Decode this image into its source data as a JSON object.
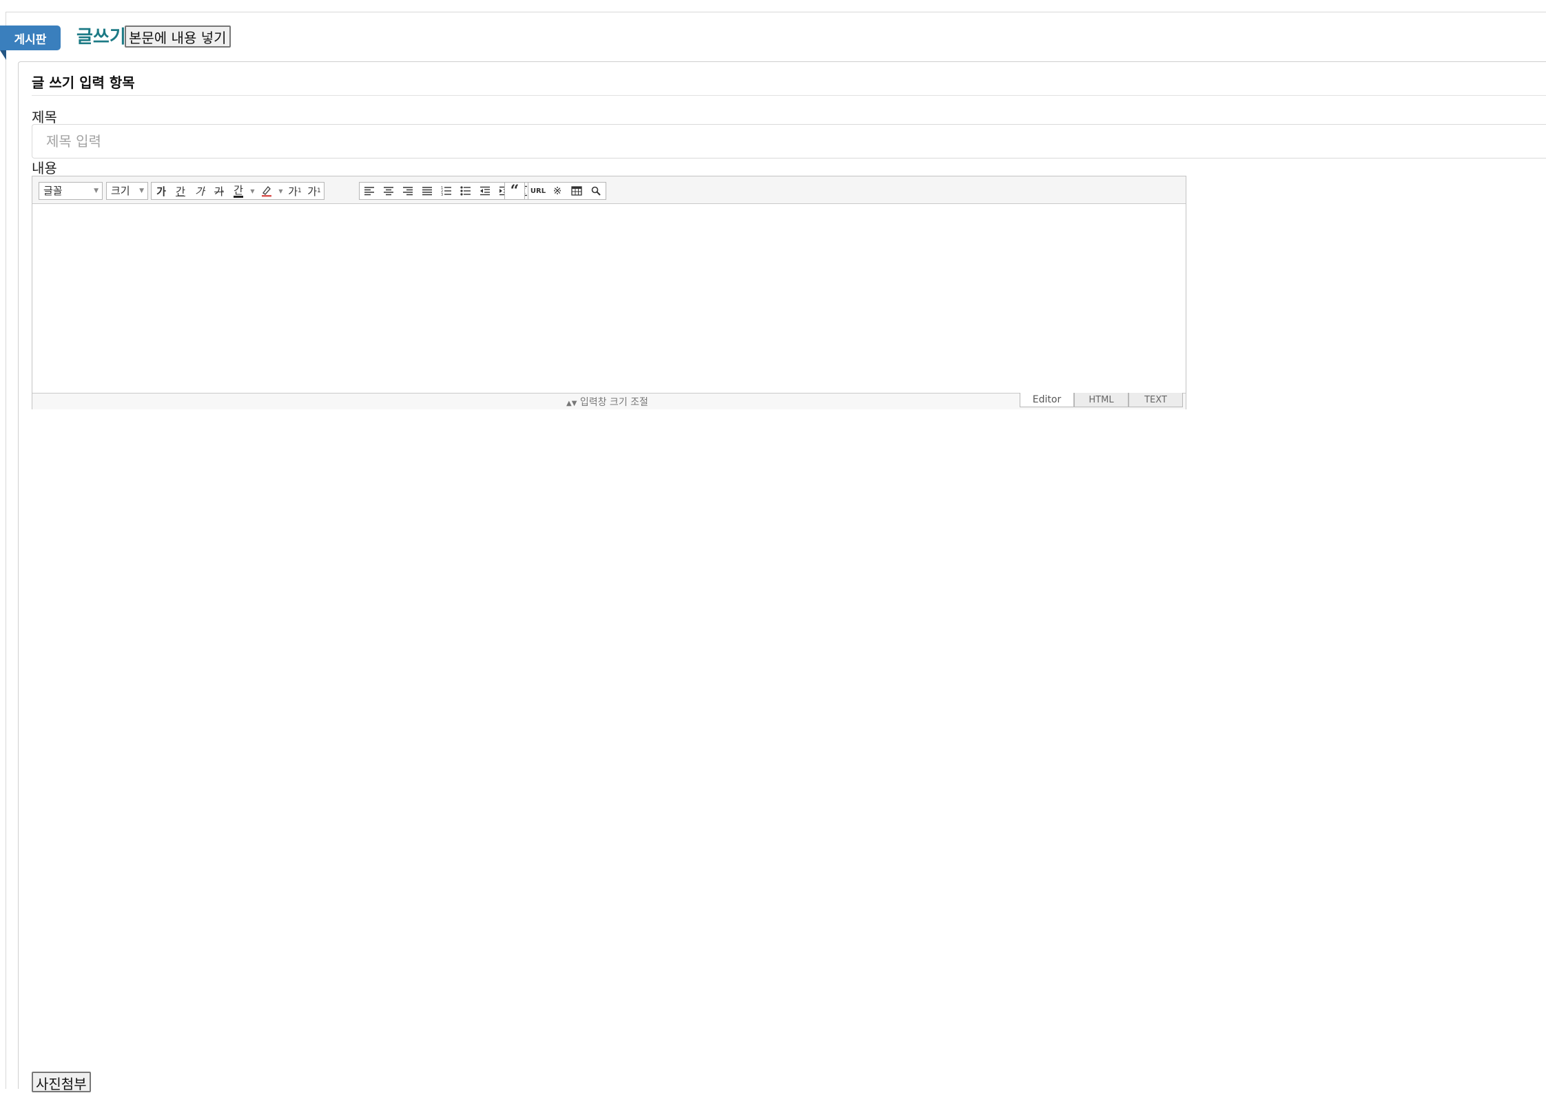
{
  "header": {
    "board_tag": "게시판",
    "page_title": "글쓰기",
    "insert_content_button": "본문에 내용 넣기"
  },
  "panel": {
    "heading": "글 쓰기 입력 항목",
    "title_label": "제목",
    "title_placeholder": "제목 입력",
    "title_value": "",
    "content_label": "내용"
  },
  "editor": {
    "font_select": "글꼴",
    "size_select": "크기",
    "format_buttons": {
      "bold": "가",
      "underline": "간",
      "italic": "가",
      "strike": "가",
      "font_color": "간",
      "superscript": "가",
      "subscript": "가"
    },
    "icons": [
      "bold-icon",
      "underline-icon",
      "italic-icon",
      "strikethrough-icon",
      "font-color-icon",
      "highlight-icon",
      "superscript-icon",
      "subscript-icon",
      "align-left-icon",
      "align-center-icon",
      "align-right-icon",
      "align-justify-icon",
      "ordered-list-icon",
      "unordered-list-icon",
      "outdent-icon",
      "indent-icon",
      "line-height-icon",
      "quote-icon",
      "url-icon",
      "special-char-icon",
      "table-icon",
      "search-icon"
    ],
    "url_button": "URL",
    "resize_label": "입력창 크기 조절",
    "modes": [
      "Editor",
      "HTML",
      "TEXT"
    ],
    "active_mode": "Editor"
  },
  "footer": {
    "photo_attach_button": "사진첨부"
  },
  "colors": {
    "tag_bg": "#3a7fbd",
    "title_link": "#1c7a85"
  }
}
